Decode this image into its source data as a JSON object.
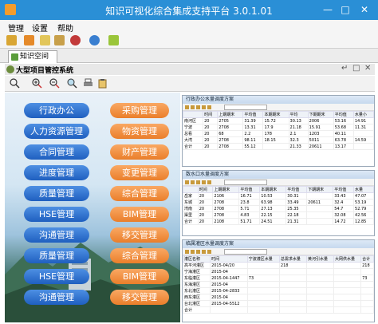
{
  "window": {
    "title": "知识可视化综合集成支持平台 3.0.1.01",
    "minimize": "—",
    "maximize": "□",
    "close": "✕"
  },
  "menu": [
    "管理",
    "设置",
    "帮助"
  ],
  "tab": {
    "label": "知识空间"
  },
  "panel": {
    "title": "大型项目管控系统",
    "controls": [
      "↵",
      "□",
      "✕"
    ]
  },
  "left_buttons": {
    "blue": [
      "行政办公",
      "人力资源管理",
      "合同管理",
      "进度管理",
      "质量管理",
      "HSE管理",
      "沟通管理",
      "质量管理",
      "HSE管理",
      "沟通管理"
    ],
    "orange": [
      "采购管理",
      "物资管理",
      "财产管理",
      "变更管理",
      "综合管理",
      "BIM管理",
      "移交管理",
      "综合管理",
      "BIM管理",
      "移交管理"
    ]
  },
  "subwindows": [
    {
      "title": "行政办公水量调度方案",
      "headers": [
        "",
        "时间",
        "上期期末",
        "平均值",
        "本期期末",
        "平均",
        "下期期末",
        "平均值",
        "水量小"
      ],
      "rows": [
        [
          "南河区",
          "20",
          "2705",
          "31.39",
          "15.72",
          "30.13",
          "2006",
          "53.16",
          "14.91"
        ],
        [
          "宁波",
          "20",
          "2708",
          "13.31",
          "17.9",
          "21.18",
          "15.91",
          "53.68",
          "11.31"
        ],
        [
          "总看",
          "20",
          "68",
          "2.2",
          "178",
          "2.1",
          "1203",
          "40.11",
          ""
        ],
        [
          "大湾",
          "20",
          "2708",
          "98.11",
          "18.15",
          "32.3",
          "5011",
          "63.78",
          "14.59"
        ],
        [
          "合计",
          "20",
          "2708",
          "55.12",
          "",
          "21.33",
          "20611",
          "13.17",
          ""
        ]
      ]
    },
    {
      "title": "数水口水量调度方案",
      "headers": [
        "",
        "时间",
        "上期期末",
        "平均值",
        "本期期末",
        "平均值",
        "下期期末",
        "平均值",
        "水量"
      ],
      "rows": [
        [
          "岳家",
          "20",
          "2106",
          "16.71",
          "10.53",
          "30.31",
          "",
          "33.43",
          "47.07"
        ],
        [
          "东城",
          "20",
          "2708",
          "23.8",
          "63.98",
          "33.49",
          "20611",
          "32.4",
          "53.19"
        ],
        [
          "湾南",
          "20",
          "2708",
          "5.71",
          "27.13",
          "25.35",
          "",
          "54.7",
          "52.79"
        ],
        [
          "渠里",
          "20",
          "2708",
          "4.83",
          "22.15",
          "22.18",
          "",
          "32.08",
          "42.56"
        ],
        [
          "合计",
          "20",
          "2108",
          "51.71",
          "24.51",
          "21.31",
          "",
          "14.72",
          "12.85"
        ]
      ]
    },
    {
      "title": "临属灌区水量调度方案",
      "headers": [
        "灌区名称",
        "时间",
        "宁波灌区水量",
        "总需求水量",
        "黄河引水量",
        "大网供水量",
        "合计"
      ],
      "rows": [
        [
          "高平河灌区",
          "2015-04/20",
          "",
          "218",
          "",
          "",
          "218"
        ],
        [
          "宁海灌区",
          "2015-04",
          "",
          "",
          "",
          "",
          ""
        ],
        [
          "东临灌区",
          "2015-04-1447",
          "73",
          "",
          "",
          "",
          "73"
        ],
        [
          "东海灌区",
          "2015-04",
          "",
          "",
          "",
          "",
          ""
        ],
        [
          "东北灌区",
          "2015-04-2833",
          "",
          "",
          "",
          "",
          ""
        ],
        [
          "西东灌区",
          "2015-04",
          "",
          "",
          "",
          "",
          ""
        ],
        [
          "台北灌区",
          "2015-04-5512",
          "",
          "",
          "",
          "",
          ""
        ],
        [
          "合计",
          "",
          "",
          "",
          "",
          "",
          ""
        ]
      ]
    }
  ]
}
